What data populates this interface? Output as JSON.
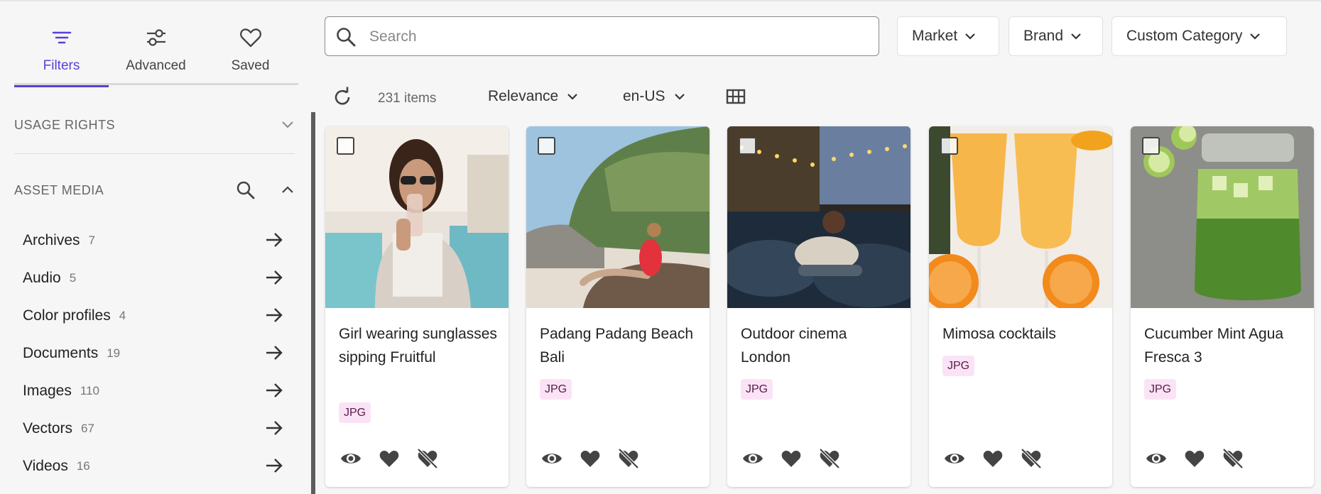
{
  "sidebar": {
    "tabs": [
      {
        "label": "Filters",
        "icon": "filter-lines-icon",
        "active": true
      },
      {
        "label": "Advanced",
        "icon": "sliders-icon",
        "active": false
      },
      {
        "label": "Saved",
        "icon": "heart-outline-icon",
        "active": false
      }
    ],
    "usage_rights": {
      "title": "USAGE RIGHTS"
    },
    "asset_media": {
      "title": "ASSET MEDIA",
      "items": [
        {
          "label": "Archives",
          "count": "7"
        },
        {
          "label": "Audio",
          "count": "5"
        },
        {
          "label": "Color profiles",
          "count": "4"
        },
        {
          "label": "Documents",
          "count": "19"
        },
        {
          "label": "Images",
          "count": "110"
        },
        {
          "label": "Vectors",
          "count": "67"
        },
        {
          "label": "Videos",
          "count": "16"
        }
      ]
    }
  },
  "search": {
    "placeholder": "Search",
    "value": ""
  },
  "filters": {
    "market": "Market",
    "brand": "Brand",
    "custom_category": "Custom Category"
  },
  "toolbar": {
    "items_count": "231 items",
    "sort": "Relevance",
    "locale": "en-US"
  },
  "cards": [
    {
      "title": "Girl wearing sunglasses sipping Fruitful",
      "badge": "JPG"
    },
    {
      "title": "Padang Padang Beach Bali",
      "badge": "JPG"
    },
    {
      "title": "Outdoor cinema London",
      "badge": "JPG"
    },
    {
      "title": "Mimosa cocktails",
      "badge": "JPG"
    },
    {
      "title": "Cucumber Mint Agua Fresca 3",
      "badge": "JPG"
    }
  ],
  "colors": {
    "accent": "#5b3fd6",
    "badge_bg": "#fbe3f6",
    "badge_text": "#5a1a4a"
  }
}
